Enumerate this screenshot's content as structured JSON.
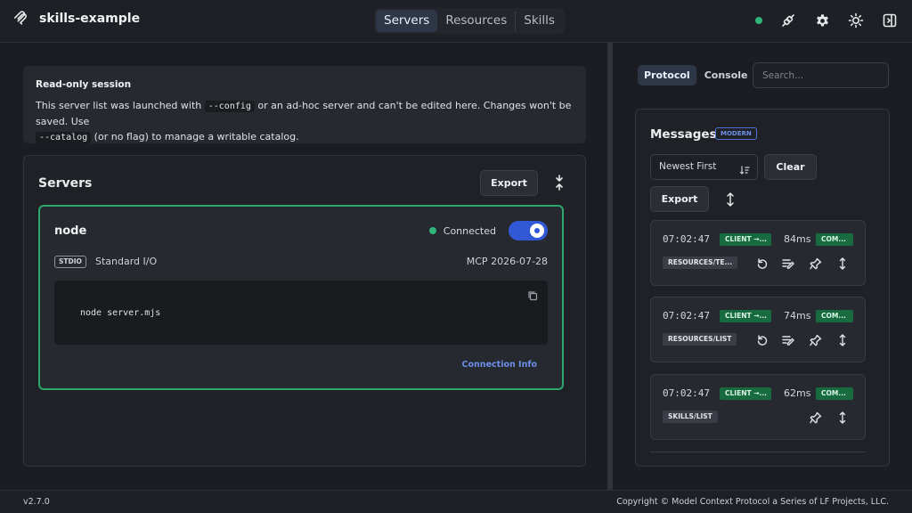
{
  "app": {
    "title": "skills-example",
    "logo_icon": "mcp-logo-icon"
  },
  "nav": {
    "tabs": [
      {
        "label": "Servers",
        "active": true
      },
      {
        "label": "Resources",
        "active": false
      },
      {
        "label": "Skills",
        "active": false
      }
    ]
  },
  "toolbar": {
    "status_color": "#2fb57a",
    "icons": [
      "connection-icon",
      "gear-icon",
      "sun-icon",
      "sidebar-toggle-icon"
    ]
  },
  "notice": {
    "title": "Read-only session",
    "text_1": "This server list was launched with ",
    "code_1": "--config",
    "text_2": " or an ad-hoc server and can't be edited here. Changes won't be saved. Use",
    "code_2": "--catalog",
    "text_3": " (or no flag) to manage a writable catalog."
  },
  "servers": {
    "title": "Servers",
    "export_label": "Export",
    "items": [
      {
        "name": "node",
        "status": "Connected",
        "enabled": true,
        "transport_badge": "STDIO",
        "transport_label": "Standard I/O",
        "protocol_version": "MCP 2026-07-28",
        "command": "node server.mjs",
        "link_label": "Connection Info"
      }
    ]
  },
  "panel": {
    "tabs": [
      {
        "label": "Protocol",
        "active": true
      },
      {
        "label": "Console",
        "active": false
      }
    ],
    "search_placeholder": "Search..."
  },
  "messages": {
    "title": "Messages",
    "badge": "MODERN",
    "sort_label": "Newest First",
    "clear_label": "Clear",
    "export_label": "Export",
    "items": [
      {
        "time": "07:02:47",
        "direction": "CLIENT →...",
        "duration": "84ms",
        "status": "COM...",
        "method": "RESOURCES/TE...",
        "has_replay": true
      },
      {
        "time": "07:02:47",
        "direction": "CLIENT →...",
        "duration": "74ms",
        "status": "COM...",
        "method": "RESOURCES/LIST",
        "has_replay": true
      },
      {
        "time": "07:02:47",
        "direction": "CLIENT →...",
        "duration": "62ms",
        "status": "COM...",
        "method": "SKILLS/LIST",
        "has_replay": false
      }
    ]
  },
  "footer": {
    "version": "v2.7.0",
    "copyright": "Copyright © Model Context Protocol a Series of LF Projects, LLC."
  },
  "colors": {
    "accent": "#3159d6",
    "success": "#2fb57a",
    "link": "#6c8fe8"
  }
}
